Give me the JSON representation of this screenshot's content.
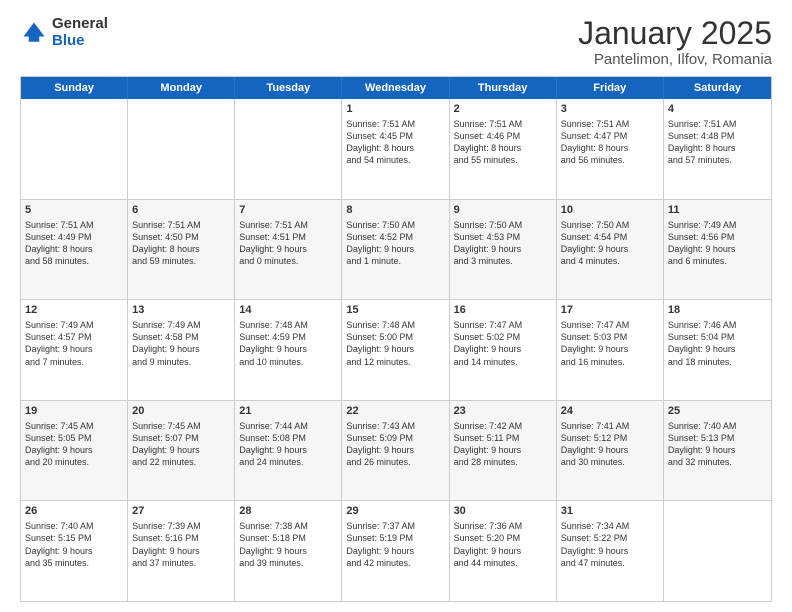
{
  "logo": {
    "general": "General",
    "blue": "Blue"
  },
  "title": {
    "month": "January 2025",
    "location": "Pantelimon, Ilfov, Romania"
  },
  "header_days": [
    "Sunday",
    "Monday",
    "Tuesday",
    "Wednesday",
    "Thursday",
    "Friday",
    "Saturday"
  ],
  "rows": [
    {
      "alt": false,
      "cells": [
        {
          "day": "",
          "content": ""
        },
        {
          "day": "",
          "content": ""
        },
        {
          "day": "",
          "content": ""
        },
        {
          "day": "1",
          "content": "Sunrise: 7:51 AM\nSunset: 4:45 PM\nDaylight: 8 hours\nand 54 minutes."
        },
        {
          "day": "2",
          "content": "Sunrise: 7:51 AM\nSunset: 4:46 PM\nDaylight: 8 hours\nand 55 minutes."
        },
        {
          "day": "3",
          "content": "Sunrise: 7:51 AM\nSunset: 4:47 PM\nDaylight: 8 hours\nand 56 minutes."
        },
        {
          "day": "4",
          "content": "Sunrise: 7:51 AM\nSunset: 4:48 PM\nDaylight: 8 hours\nand 57 minutes."
        }
      ]
    },
    {
      "alt": true,
      "cells": [
        {
          "day": "5",
          "content": "Sunrise: 7:51 AM\nSunset: 4:49 PM\nDaylight: 8 hours\nand 58 minutes."
        },
        {
          "day": "6",
          "content": "Sunrise: 7:51 AM\nSunset: 4:50 PM\nDaylight: 8 hours\nand 59 minutes."
        },
        {
          "day": "7",
          "content": "Sunrise: 7:51 AM\nSunset: 4:51 PM\nDaylight: 9 hours\nand 0 minutes."
        },
        {
          "day": "8",
          "content": "Sunrise: 7:50 AM\nSunset: 4:52 PM\nDaylight: 9 hours\nand 1 minute."
        },
        {
          "day": "9",
          "content": "Sunrise: 7:50 AM\nSunset: 4:53 PM\nDaylight: 9 hours\nand 3 minutes."
        },
        {
          "day": "10",
          "content": "Sunrise: 7:50 AM\nSunset: 4:54 PM\nDaylight: 9 hours\nand 4 minutes."
        },
        {
          "day": "11",
          "content": "Sunrise: 7:49 AM\nSunset: 4:56 PM\nDaylight: 9 hours\nand 6 minutes."
        }
      ]
    },
    {
      "alt": false,
      "cells": [
        {
          "day": "12",
          "content": "Sunrise: 7:49 AM\nSunset: 4:57 PM\nDaylight: 9 hours\nand 7 minutes."
        },
        {
          "day": "13",
          "content": "Sunrise: 7:49 AM\nSunset: 4:58 PM\nDaylight: 9 hours\nand 9 minutes."
        },
        {
          "day": "14",
          "content": "Sunrise: 7:48 AM\nSunset: 4:59 PM\nDaylight: 9 hours\nand 10 minutes."
        },
        {
          "day": "15",
          "content": "Sunrise: 7:48 AM\nSunset: 5:00 PM\nDaylight: 9 hours\nand 12 minutes."
        },
        {
          "day": "16",
          "content": "Sunrise: 7:47 AM\nSunset: 5:02 PM\nDaylight: 9 hours\nand 14 minutes."
        },
        {
          "day": "17",
          "content": "Sunrise: 7:47 AM\nSunset: 5:03 PM\nDaylight: 9 hours\nand 16 minutes."
        },
        {
          "day": "18",
          "content": "Sunrise: 7:46 AM\nSunset: 5:04 PM\nDaylight: 9 hours\nand 18 minutes."
        }
      ]
    },
    {
      "alt": true,
      "cells": [
        {
          "day": "19",
          "content": "Sunrise: 7:45 AM\nSunset: 5:05 PM\nDaylight: 9 hours\nand 20 minutes."
        },
        {
          "day": "20",
          "content": "Sunrise: 7:45 AM\nSunset: 5:07 PM\nDaylight: 9 hours\nand 22 minutes."
        },
        {
          "day": "21",
          "content": "Sunrise: 7:44 AM\nSunset: 5:08 PM\nDaylight: 9 hours\nand 24 minutes."
        },
        {
          "day": "22",
          "content": "Sunrise: 7:43 AM\nSunset: 5:09 PM\nDaylight: 9 hours\nand 26 minutes."
        },
        {
          "day": "23",
          "content": "Sunrise: 7:42 AM\nSunset: 5:11 PM\nDaylight: 9 hours\nand 28 minutes."
        },
        {
          "day": "24",
          "content": "Sunrise: 7:41 AM\nSunset: 5:12 PM\nDaylight: 9 hours\nand 30 minutes."
        },
        {
          "day": "25",
          "content": "Sunrise: 7:40 AM\nSunset: 5:13 PM\nDaylight: 9 hours\nand 32 minutes."
        }
      ]
    },
    {
      "alt": false,
      "cells": [
        {
          "day": "26",
          "content": "Sunrise: 7:40 AM\nSunset: 5:15 PM\nDaylight: 9 hours\nand 35 minutes."
        },
        {
          "day": "27",
          "content": "Sunrise: 7:39 AM\nSunset: 5:16 PM\nDaylight: 9 hours\nand 37 minutes."
        },
        {
          "day": "28",
          "content": "Sunrise: 7:38 AM\nSunset: 5:18 PM\nDaylight: 9 hours\nand 39 minutes."
        },
        {
          "day": "29",
          "content": "Sunrise: 7:37 AM\nSunset: 5:19 PM\nDaylight: 9 hours\nand 42 minutes."
        },
        {
          "day": "30",
          "content": "Sunrise: 7:36 AM\nSunset: 5:20 PM\nDaylight: 9 hours\nand 44 minutes."
        },
        {
          "day": "31",
          "content": "Sunrise: 7:34 AM\nSunset: 5:22 PM\nDaylight: 9 hours\nand 47 minutes."
        },
        {
          "day": "",
          "content": ""
        }
      ]
    }
  ]
}
